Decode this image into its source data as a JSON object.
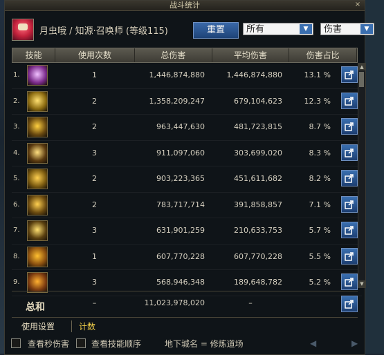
{
  "window": {
    "title": "战斗统计",
    "close": "×"
  },
  "character": {
    "name": "月虫哦 / 知源·召唤师 (等级115)"
  },
  "controls": {
    "reset_label": "重置",
    "filter_value": "所有",
    "metric_value": "伤害"
  },
  "table": {
    "headers": [
      "技能",
      "使用次数",
      "总伤害",
      "平均伤害",
      "伤害占比"
    ],
    "rows": [
      {
        "rank": "1.",
        "uses": "1",
        "total": "1,446,874,880",
        "avg": "1,446,874,880",
        "pct": "13.1 %"
      },
      {
        "rank": "2.",
        "uses": "2",
        "total": "1,358,209,247",
        "avg": "679,104,623",
        "pct": "12.3 %"
      },
      {
        "rank": "3.",
        "uses": "2",
        "total": "963,447,630",
        "avg": "481,723,815",
        "pct": "8.7 %"
      },
      {
        "rank": "4.",
        "uses": "3",
        "total": "911,097,060",
        "avg": "303,699,020",
        "pct": "8.3 %"
      },
      {
        "rank": "5.",
        "uses": "2",
        "total": "903,223,365",
        "avg": "451,611,682",
        "pct": "8.2 %"
      },
      {
        "rank": "6.",
        "uses": "2",
        "total": "783,717,714",
        "avg": "391,858,857",
        "pct": "7.1 %"
      },
      {
        "rank": "7.",
        "uses": "3",
        "total": "631,901,259",
        "avg": "210,633,753",
        "pct": "5.7 %"
      },
      {
        "rank": "8.",
        "uses": "1",
        "total": "607,770,228",
        "avg": "607,770,228",
        "pct": "5.5 %"
      },
      {
        "rank": "9.",
        "uses": "3",
        "total": "568,946,348",
        "avg": "189,648,782",
        "pct": "5.2 %"
      }
    ]
  },
  "summary": {
    "label": "总和",
    "uses": "–",
    "total": "11,023,978,020",
    "avg": "–"
  },
  "tabs": {
    "settings": "使用设置",
    "count": "计数"
  },
  "footer": {
    "check_dps": "查看秒伤害",
    "check_order": "查看技能顺序",
    "dungeon": "地下城名 = 修炼道场"
  },
  "icons": [
    "skill-icon-1",
    "skill-icon-2",
    "skill-icon-3",
    "skill-icon-4",
    "skill-icon-5",
    "skill-icon-6",
    "skill-icon-7",
    "skill-icon-8",
    "skill-icon-9",
    "share-icon"
  ],
  "colors": {
    "accent_blue": "#2a5aa0",
    "tab_active": "#f2d04a",
    "text": "#d6d0c0"
  }
}
